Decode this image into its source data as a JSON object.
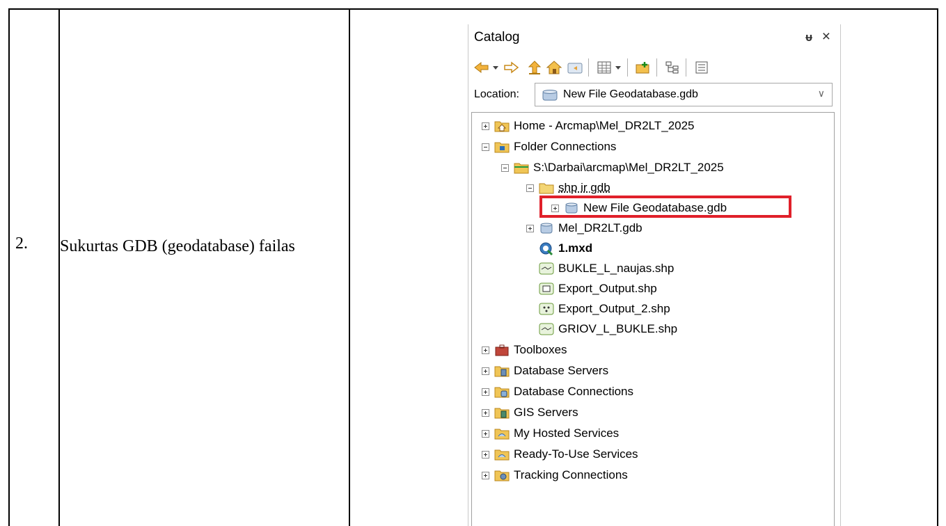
{
  "document": {
    "step_number": "2.",
    "description": "Sukurtas GDB (geodatabase) failas"
  },
  "catalog": {
    "title": "Catalog",
    "pin_glyph": "ᵾ",
    "close_glyph": "×",
    "location_label": "Location:",
    "location_value": "New File Geodatabase.gdb",
    "toolbar_icons": [
      "back-arrow-icon",
      "dropdown-arrow-icon",
      "forward-arrow-icon",
      "up-one-level-icon",
      "home-icon",
      "connect-folder-icon",
      "toggle-contents-icon",
      "view-dropdown-icon",
      "new-item-icon",
      "tree-view-icon",
      "options-icon"
    ],
    "tree": [
      {
        "label": "Home - Arcmap\\Mel_DR2LT_2025",
        "icon": "home-folder-icon",
        "expander": "plus"
      },
      {
        "label": "Folder Connections",
        "icon": "folder-connections-icon",
        "expander": "minus"
      },
      {
        "label": "S:\\Darbai\\arcmap\\Mel_DR2LT_2025",
        "icon": "folder-icon",
        "expander": "minus"
      },
      {
        "label": "shp ir gdb",
        "icon": "folder-icon",
        "expander": "minus"
      },
      {
        "label": "New File Geodatabase.gdb",
        "icon": "geodatabase-icon",
        "expander": "plus"
      },
      {
        "label": "Mel_DR2LT.gdb",
        "icon": "geodatabase-icon",
        "expander": "plus"
      },
      {
        "label": "1.mxd",
        "icon": "map-document-icon",
        "expander": ""
      },
      {
        "label": "BUKLE_L_naujas.shp",
        "icon": "line-shapefile-icon",
        "expander": ""
      },
      {
        "label": "Export_Output.shp",
        "icon": "polygon-shapefile-icon",
        "expander": ""
      },
      {
        "label": "Export_Output_2.shp",
        "icon": "point-shapefile-icon",
        "expander": ""
      },
      {
        "label": "GRIOV_L_BUKLE.shp",
        "icon": "line-shapefile-icon",
        "expander": ""
      },
      {
        "label": "Toolboxes",
        "icon": "toolbox-icon",
        "expander": "plus"
      },
      {
        "label": "Database Servers",
        "icon": "database-servers-icon",
        "expander": "plus"
      },
      {
        "label": "Database Connections",
        "icon": "database-connections-icon",
        "expander": "plus"
      },
      {
        "label": "GIS Servers",
        "icon": "gis-servers-icon",
        "expander": "plus"
      },
      {
        "label": "My Hosted Services",
        "icon": "hosted-services-icon",
        "expander": "plus"
      },
      {
        "label": "Ready-To-Use Services",
        "icon": "hosted-services-icon",
        "expander": "plus"
      },
      {
        "label": "Tracking Connections",
        "icon": "tracking-connections-icon",
        "expander": "plus"
      }
    ],
    "highlight_color": "#e0202a"
  }
}
